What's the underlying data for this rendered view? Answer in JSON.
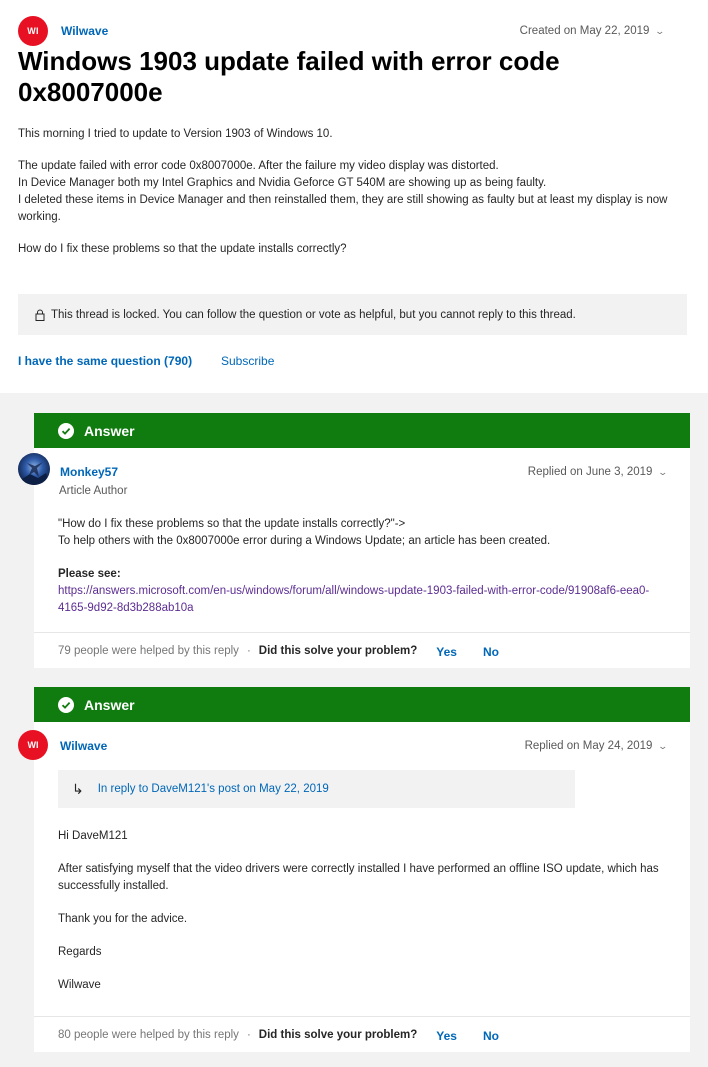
{
  "question": {
    "author_initials": "WI",
    "author_name": "Wilwave",
    "created": "Created on May 22, 2019",
    "title": "Windows 1903 update failed with error code 0x8007000e",
    "body": [
      "This morning I tried to update to Version 1903 of Windows 10.",
      "The update failed with error code 0x8007000e. After the failure my video display was distorted.",
      "In Device Manager both my Intel Graphics and Nvidia Geforce GT 540M are showing up as being faulty.",
      "I deleted these items in Device Manager and then reinstalled them, they are still showing as faulty but at least my display is now working.",
      "How do I fix these problems so that the update installs correctly?"
    ],
    "locked_notice": "This thread is locked. You can follow the question or vote as helpful, but you cannot reply to this thread.",
    "same_question_label": "I have the same question (790)",
    "subscribe_label": "Subscribe"
  },
  "answers": [
    {
      "banner": "Answer",
      "author_name": "Monkey57",
      "author_role": "Article Author",
      "date": "Replied on June 3, 2019",
      "quote": "\"How do I fix these problems so that the update installs correctly?\"->",
      "line2": "To help others with the 0x8007000e error during a Windows Update; an article has been created.",
      "please_see": "Please see:",
      "link": "https://answers.microsoft.com/en-us/windows/forum/all/windows-update-1903-failed-with-error-code/91908af6-eea0-4165-9d92-8d3b288ab10a",
      "helped": "79 people were helped by this reply",
      "solve_prompt": "Did this solve your problem?",
      "yes": "Yes",
      "no": "No"
    },
    {
      "banner": "Answer",
      "author_initials": "WI",
      "author_name": "Wilwave",
      "date": "Replied on May 24, 2019",
      "in_reply_to": "In reply to DaveM121's post on May 22, 2019",
      "body": [
        "Hi DaveM121",
        "After satisfying myself that the video drivers were correctly installed I have performed an offline ISO update, which has successfully installed.",
        "Thank you for the advice.",
        "Regards",
        "Wilwave"
      ],
      "helped": "80 people were helped by this reply",
      "solve_prompt": "Did this solve your problem?",
      "yes": "Yes",
      "no": "No"
    }
  ],
  "colors": {
    "accent": "#0067b8",
    "answer_banner": "#107c10",
    "avatar_red": "#e81123",
    "visited_link": "#5c2d91"
  },
  "icons": [
    "lock-icon",
    "checkmark-icon",
    "chevron-down-icon",
    "reply-arrow-icon"
  ]
}
